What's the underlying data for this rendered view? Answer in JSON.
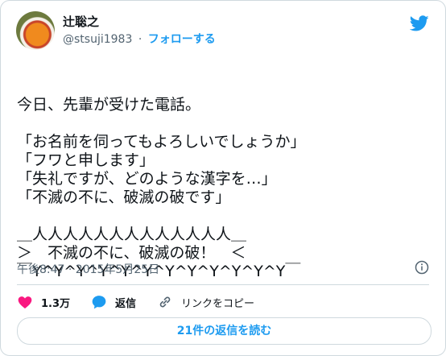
{
  "author": {
    "name": "辻聡之",
    "handle": "@stsuji1983",
    "separator": "·",
    "follow_label": "フォローする"
  },
  "tweet": {
    "text_lines": [
      "今日、先輩が受けた電話。",
      "",
      "「お名前を伺ってもよろしいでしょうか」",
      "「フワと申します」",
      "「失礼ですが、どのような漢字を…」",
      "「不滅の不に、破滅の破です」",
      "",
      "＿人人人人人人人人人人人人人＿",
      "＞　不滅の不に、破滅の破！　＜",
      "￣Y^Y^Y^Y^Y^Y^Y^Y^Y^Y^Y^Y￣"
    ],
    "timestamp": "午後8:47 · 2015年5月25日"
  },
  "actions": {
    "like_count": "1.3万",
    "reply_label": "返信",
    "copy_link_label": "リンクをコピー"
  },
  "replies_button": "21件の返信を読む",
  "colors": {
    "accent": "#1d9bf0",
    "like": "#f91880",
    "muted": "#536471"
  },
  "icons": [
    "twitter-bird-icon",
    "info-icon",
    "heart-icon",
    "reply-icon",
    "link-icon"
  ]
}
